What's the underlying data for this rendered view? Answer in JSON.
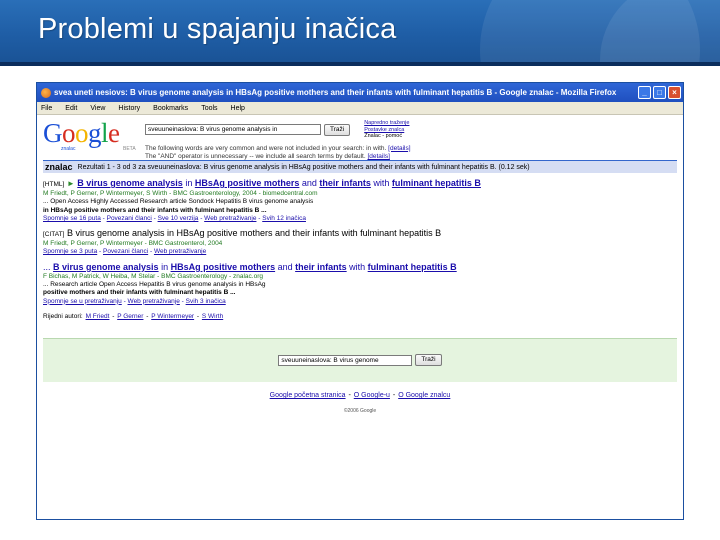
{
  "slide": {
    "title": "Problemi u spajanju inačica"
  },
  "window": {
    "title": "svea uneti nesiovs: B virus genome analysis in HBsAg positive mothers and their infants with fulminant hepatitis B - Google znalac - Mozilla Firefox",
    "buttons": {
      "minimize": "_",
      "maximize": "□",
      "close": "×"
    }
  },
  "menu": [
    "File",
    "Edit",
    "View",
    "History",
    "Bookmarks",
    "Tools",
    "Help"
  ],
  "logo": {
    "g1": "G",
    "o1": "o",
    "o2": "o",
    "g2": "g",
    "l": "l",
    "e": "e",
    "sub": "znalac",
    "beta": "BETA"
  },
  "search": {
    "query": "sveuuneinaslova: B virus genome analysis in",
    "button": "Traži",
    "side_links": [
      "Napredno traženje",
      "Postavke znalca",
      "Znalac - pomoć"
    ],
    "notice_1": "The following words are very common and were not included in your search: in with.",
    "notice_1_link": "[details]",
    "notice_2": "The \"AND\" operator is unnecessary -- we include all search terms by default.",
    "notice_2_link": "[details]"
  },
  "results_bar": {
    "brand": "znalac",
    "text": "Rezultati 1 - 3 od 3 za sveuuneinaslova: B virus genome analysis in HBsAg positive mothers and their infants with fulminant hepatitis B. (0.12 sek)"
  },
  "results": [
    {
      "tag": "[HTML]",
      "arrow": "►",
      "title_pre": "",
      "title": [
        "B virus genome analysis",
        " in ",
        "HBsAg positive mothers",
        " and ",
        "their infants",
        " with ",
        "fulminant hepatitis B"
      ],
      "meta": "M Friedt, P Gerner, P Wintermeyer, S Wirth - BMC Gastroenterology, 2004 - biomedcentral.com",
      "snippet": [
        "... Open Access Highly Accessed Research article Sondock Hepatitis B virus genome analysis",
        "in HBsAg positive mothers and their infants with fulminant hepatitis B ..."
      ],
      "links": [
        "Spomnje se 16 puta",
        "Povezani članci",
        "Sve 10 verzija",
        "Web pretraživanje",
        "Svih 12 inačica"
      ]
    },
    {
      "tag": "[CITAT]",
      "arrow": "",
      "title_pre": "",
      "title": [
        "B virus genome analysis in HBsAg positive mothers and their infants with fulminant hepatitis B"
      ],
      "meta": "M Friedt, P Gerner, P Wintermeyer - BMC Gastroenterol, 2004",
      "snippet": [],
      "links": [
        "Spomnje se 3 puta",
        "Povezani članci",
        "Web pretraživanje"
      ]
    },
    {
      "tag": "",
      "arrow": "",
      "title_pre": "... ",
      "title": [
        "B virus genome analysis",
        " in ",
        "HBsAg positive mothers",
        " and ",
        "their infants",
        " with ",
        "fulminant hepatitis B"
      ],
      "meta": "F Bichas, M Patrick, W Heiba, M Stelar - BMC Gastroenterology - znalac.org",
      "snippet": [
        "... Research article Open Access Hepatitis B virus genome analysis in HBsAg",
        "positive mothers and their infants with fulminant hepatitis B ..."
      ],
      "links": [
        "Spomnje se u pretraživanju",
        "Web pretraživanje",
        "Svih 3 inačica"
      ]
    }
  ],
  "related": {
    "label": "Rijedni autori:",
    "authors": [
      "M Friedt",
      "P Gerner",
      "P Wintermeyer",
      "S Wirth"
    ]
  },
  "bottom_search": {
    "query": "sveuuneinaslova: B virus genome",
    "button": "Traži"
  },
  "footer": {
    "links": [
      "Google početna stranica",
      "O Google-u",
      "O Google znalcu"
    ],
    "copyright": "©2006 Google"
  },
  "colors": {
    "header": "#1f5ea6",
    "link": "#1a0dab",
    "result_bar": "#d5ddf3",
    "bottom_box": "#e5f4df"
  }
}
